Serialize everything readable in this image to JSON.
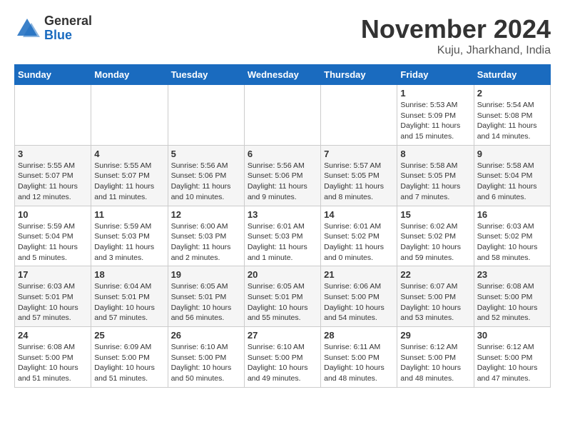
{
  "header": {
    "logo_general": "General",
    "logo_blue": "Blue",
    "month_title": "November 2024",
    "location": "Kuju, Jharkhand, India"
  },
  "calendar": {
    "days_of_week": [
      "Sunday",
      "Monday",
      "Tuesday",
      "Wednesday",
      "Thursday",
      "Friday",
      "Saturday"
    ],
    "weeks": [
      [
        {
          "day": "",
          "info": ""
        },
        {
          "day": "",
          "info": ""
        },
        {
          "day": "",
          "info": ""
        },
        {
          "day": "",
          "info": ""
        },
        {
          "day": "",
          "info": ""
        },
        {
          "day": "1",
          "info": "Sunrise: 5:53 AM\nSunset: 5:09 PM\nDaylight: 11 hours and 15 minutes."
        },
        {
          "day": "2",
          "info": "Sunrise: 5:54 AM\nSunset: 5:08 PM\nDaylight: 11 hours and 14 minutes."
        }
      ],
      [
        {
          "day": "3",
          "info": "Sunrise: 5:55 AM\nSunset: 5:07 PM\nDaylight: 11 hours and 12 minutes."
        },
        {
          "day": "4",
          "info": "Sunrise: 5:55 AM\nSunset: 5:07 PM\nDaylight: 11 hours and 11 minutes."
        },
        {
          "day": "5",
          "info": "Sunrise: 5:56 AM\nSunset: 5:06 PM\nDaylight: 11 hours and 10 minutes."
        },
        {
          "day": "6",
          "info": "Sunrise: 5:56 AM\nSunset: 5:06 PM\nDaylight: 11 hours and 9 minutes."
        },
        {
          "day": "7",
          "info": "Sunrise: 5:57 AM\nSunset: 5:05 PM\nDaylight: 11 hours and 8 minutes."
        },
        {
          "day": "8",
          "info": "Sunrise: 5:58 AM\nSunset: 5:05 PM\nDaylight: 11 hours and 7 minutes."
        },
        {
          "day": "9",
          "info": "Sunrise: 5:58 AM\nSunset: 5:04 PM\nDaylight: 11 hours and 6 minutes."
        }
      ],
      [
        {
          "day": "10",
          "info": "Sunrise: 5:59 AM\nSunset: 5:04 PM\nDaylight: 11 hours and 5 minutes."
        },
        {
          "day": "11",
          "info": "Sunrise: 5:59 AM\nSunset: 5:03 PM\nDaylight: 11 hours and 3 minutes."
        },
        {
          "day": "12",
          "info": "Sunrise: 6:00 AM\nSunset: 5:03 PM\nDaylight: 11 hours and 2 minutes."
        },
        {
          "day": "13",
          "info": "Sunrise: 6:01 AM\nSunset: 5:03 PM\nDaylight: 11 hours and 1 minute."
        },
        {
          "day": "14",
          "info": "Sunrise: 6:01 AM\nSunset: 5:02 PM\nDaylight: 11 hours and 0 minutes."
        },
        {
          "day": "15",
          "info": "Sunrise: 6:02 AM\nSunset: 5:02 PM\nDaylight: 10 hours and 59 minutes."
        },
        {
          "day": "16",
          "info": "Sunrise: 6:03 AM\nSunset: 5:02 PM\nDaylight: 10 hours and 58 minutes."
        }
      ],
      [
        {
          "day": "17",
          "info": "Sunrise: 6:03 AM\nSunset: 5:01 PM\nDaylight: 10 hours and 57 minutes."
        },
        {
          "day": "18",
          "info": "Sunrise: 6:04 AM\nSunset: 5:01 PM\nDaylight: 10 hours and 57 minutes."
        },
        {
          "day": "19",
          "info": "Sunrise: 6:05 AM\nSunset: 5:01 PM\nDaylight: 10 hours and 56 minutes."
        },
        {
          "day": "20",
          "info": "Sunrise: 6:05 AM\nSunset: 5:01 PM\nDaylight: 10 hours and 55 minutes."
        },
        {
          "day": "21",
          "info": "Sunrise: 6:06 AM\nSunset: 5:00 PM\nDaylight: 10 hours and 54 minutes."
        },
        {
          "day": "22",
          "info": "Sunrise: 6:07 AM\nSunset: 5:00 PM\nDaylight: 10 hours and 53 minutes."
        },
        {
          "day": "23",
          "info": "Sunrise: 6:08 AM\nSunset: 5:00 PM\nDaylight: 10 hours and 52 minutes."
        }
      ],
      [
        {
          "day": "24",
          "info": "Sunrise: 6:08 AM\nSunset: 5:00 PM\nDaylight: 10 hours and 51 minutes."
        },
        {
          "day": "25",
          "info": "Sunrise: 6:09 AM\nSunset: 5:00 PM\nDaylight: 10 hours and 51 minutes."
        },
        {
          "day": "26",
          "info": "Sunrise: 6:10 AM\nSunset: 5:00 PM\nDaylight: 10 hours and 50 minutes."
        },
        {
          "day": "27",
          "info": "Sunrise: 6:10 AM\nSunset: 5:00 PM\nDaylight: 10 hours and 49 minutes."
        },
        {
          "day": "28",
          "info": "Sunrise: 6:11 AM\nSunset: 5:00 PM\nDaylight: 10 hours and 48 minutes."
        },
        {
          "day": "29",
          "info": "Sunrise: 6:12 AM\nSunset: 5:00 PM\nDaylight: 10 hours and 48 minutes."
        },
        {
          "day": "30",
          "info": "Sunrise: 6:12 AM\nSunset: 5:00 PM\nDaylight: 10 hours and 47 minutes."
        }
      ]
    ]
  }
}
